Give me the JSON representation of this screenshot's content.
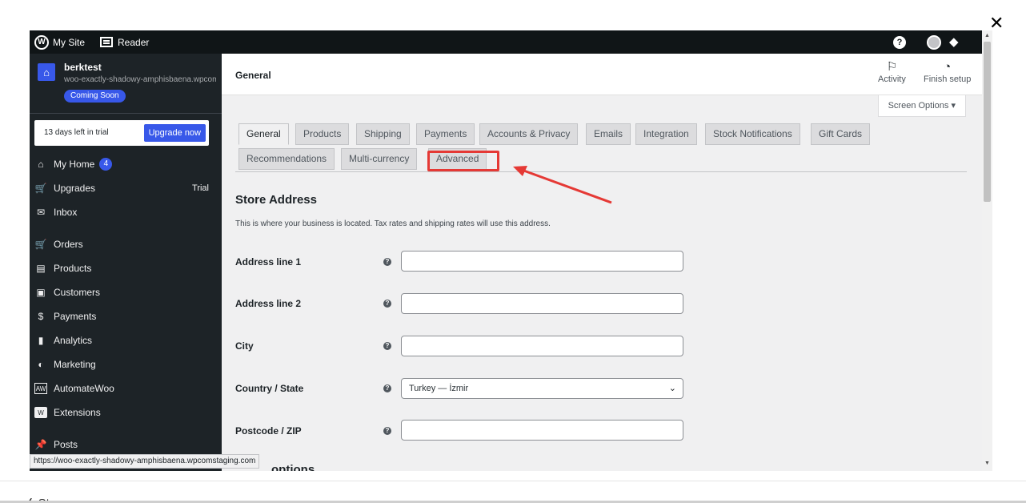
{
  "window": {
    "close_glyph": "✕",
    "footer_cut_text": "∠ Stop"
  },
  "adminbar": {
    "my_site": "My Site",
    "reader": "Reader",
    "help_glyph": "?"
  },
  "sidebar": {
    "site_name": "berktest",
    "site_url": "woo-exactly-shadowy-amphisbaena.wpcomstaging.com",
    "coming_soon": "Coming Soon",
    "trial_text": "13 days left in trial",
    "upgrade_label": "Upgrade now",
    "items": [
      {
        "label": "My Home",
        "icon": "home-icon",
        "glyph": "⌂",
        "badge": "4"
      },
      {
        "label": "Upgrades",
        "icon": "cart-icon",
        "glyph": "🛒",
        "tag": "Trial"
      },
      {
        "label": "Inbox",
        "icon": "mail-icon",
        "glyph": "✉"
      },
      {
        "label": "Orders",
        "icon": "cart-icon",
        "glyph": "🛒"
      },
      {
        "label": "Products",
        "icon": "archive-icon",
        "glyph": "▤"
      },
      {
        "label": "Customers",
        "icon": "id-card-icon",
        "glyph": "▣"
      },
      {
        "label": "Payments",
        "icon": "dollar-icon",
        "glyph": "$"
      },
      {
        "label": "Analytics",
        "icon": "bar-chart-icon",
        "glyph": "▮"
      },
      {
        "label": "Marketing",
        "icon": "megaphone-icon",
        "glyph": "◐"
      },
      {
        "label": "AutomateWoo",
        "icon": "aw-icon",
        "glyph": "AW"
      },
      {
        "label": "Extensions",
        "icon": "woo-icon",
        "glyph": "W"
      },
      {
        "label": "Posts",
        "icon": "pin-icon",
        "glyph": "📌"
      }
    ],
    "status_url": "https://woo-exactly-shadowy-amphisbaena.wpcomstaging.com"
  },
  "header": {
    "title": "General",
    "activity": "Activity",
    "finish_setup": "Finish setup",
    "screen_options": "Screen Options ▾"
  },
  "tabs": [
    "General",
    "Products",
    "Shipping",
    "Payments",
    "Accounts & Privacy",
    "Emails",
    "Integration",
    "Stock Notifications",
    "Gift Cards",
    "Recommendations",
    "Multi-currency",
    "Advanced"
  ],
  "form": {
    "section_title": "Store Address",
    "section_desc": "This is where your business is located. Tax rates and shipping rates will use this address.",
    "fields": [
      {
        "label": "Address line 1",
        "value": ""
      },
      {
        "label": "Address line 2",
        "value": ""
      },
      {
        "label": "City",
        "value": ""
      },
      {
        "label": "Country / State",
        "value": "Turkey — İzmir"
      },
      {
        "label": "Postcode / ZIP",
        "value": ""
      }
    ],
    "next_section_partial": "options"
  },
  "colors": {
    "accent": "#3858e9",
    "highlight": "#e53935",
    "sidebar_bg": "#1d2327"
  }
}
